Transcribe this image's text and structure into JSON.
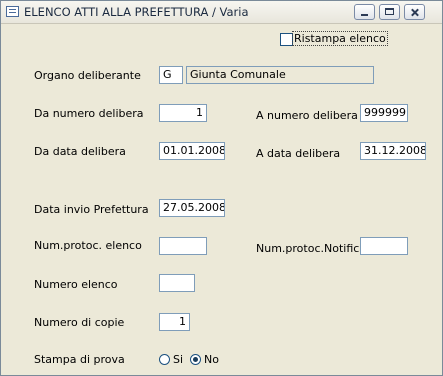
{
  "window": {
    "title": "ELENCO ATTI ALLA PREFETTURA / Varia",
    "controls": {
      "minimize": "minimize",
      "maximize": "maximize",
      "close": "close"
    }
  },
  "ristampa": {
    "label": "Ristampa elenco",
    "checked": false
  },
  "organo": {
    "label": "Organo deliberante",
    "code": "G",
    "name": "Giunta Comunale"
  },
  "da_numero": {
    "label": "Da numero delibera",
    "value": "1"
  },
  "a_numero": {
    "label": "A  numero delibera",
    "value": "999999"
  },
  "da_data": {
    "label": "Da data delibera",
    "value": "01.01.2008"
  },
  "a_data": {
    "label": "A  data delibera",
    "value": "31.12.2008"
  },
  "data_invio": {
    "label": "Data invio Prefettura",
    "value": "27.05.2008"
  },
  "num_protoc_elenco": {
    "label": "Num.protoc. elenco",
    "value": ""
  },
  "num_protoc_notifica": {
    "label": "Num.protoc.Notifica",
    "value": ""
  },
  "numero_elenco": {
    "label": "Numero elenco",
    "value": ""
  },
  "numero_copie": {
    "label": "Numero di copie",
    "value": "1"
  },
  "stampa_prova": {
    "label": "Stampa di prova",
    "options": [
      {
        "label": "Si",
        "selected": false
      },
      {
        "label": "No",
        "selected": true
      }
    ]
  }
}
